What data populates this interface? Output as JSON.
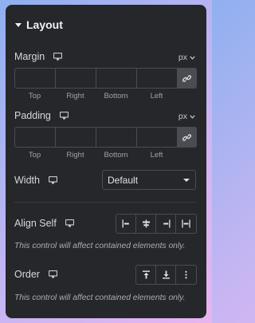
{
  "section": {
    "title": "Layout"
  },
  "margin": {
    "label": "Margin",
    "unit": "px",
    "sides": [
      "Top",
      "Right",
      "Bottom",
      "Left"
    ]
  },
  "padding": {
    "label": "Padding",
    "unit": "px",
    "sides": [
      "Top",
      "Right",
      "Bottom",
      "Left"
    ]
  },
  "width": {
    "label": "Width",
    "value": "Default"
  },
  "align_self": {
    "label": "Align Self",
    "options": [
      "align-start-icon",
      "align-center-icon",
      "align-end-icon",
      "align-stretch-icon"
    ],
    "note": "This control will affect contained elements only."
  },
  "order": {
    "label": "Order",
    "options": [
      "order-start-icon",
      "order-end-icon",
      "more-icon"
    ],
    "note": "This control will affect contained elements only."
  },
  "colors": {
    "panel": "#26272b",
    "border": "#4a4c52",
    "text": "#d5d8dc",
    "muted": "#a9adb2"
  }
}
